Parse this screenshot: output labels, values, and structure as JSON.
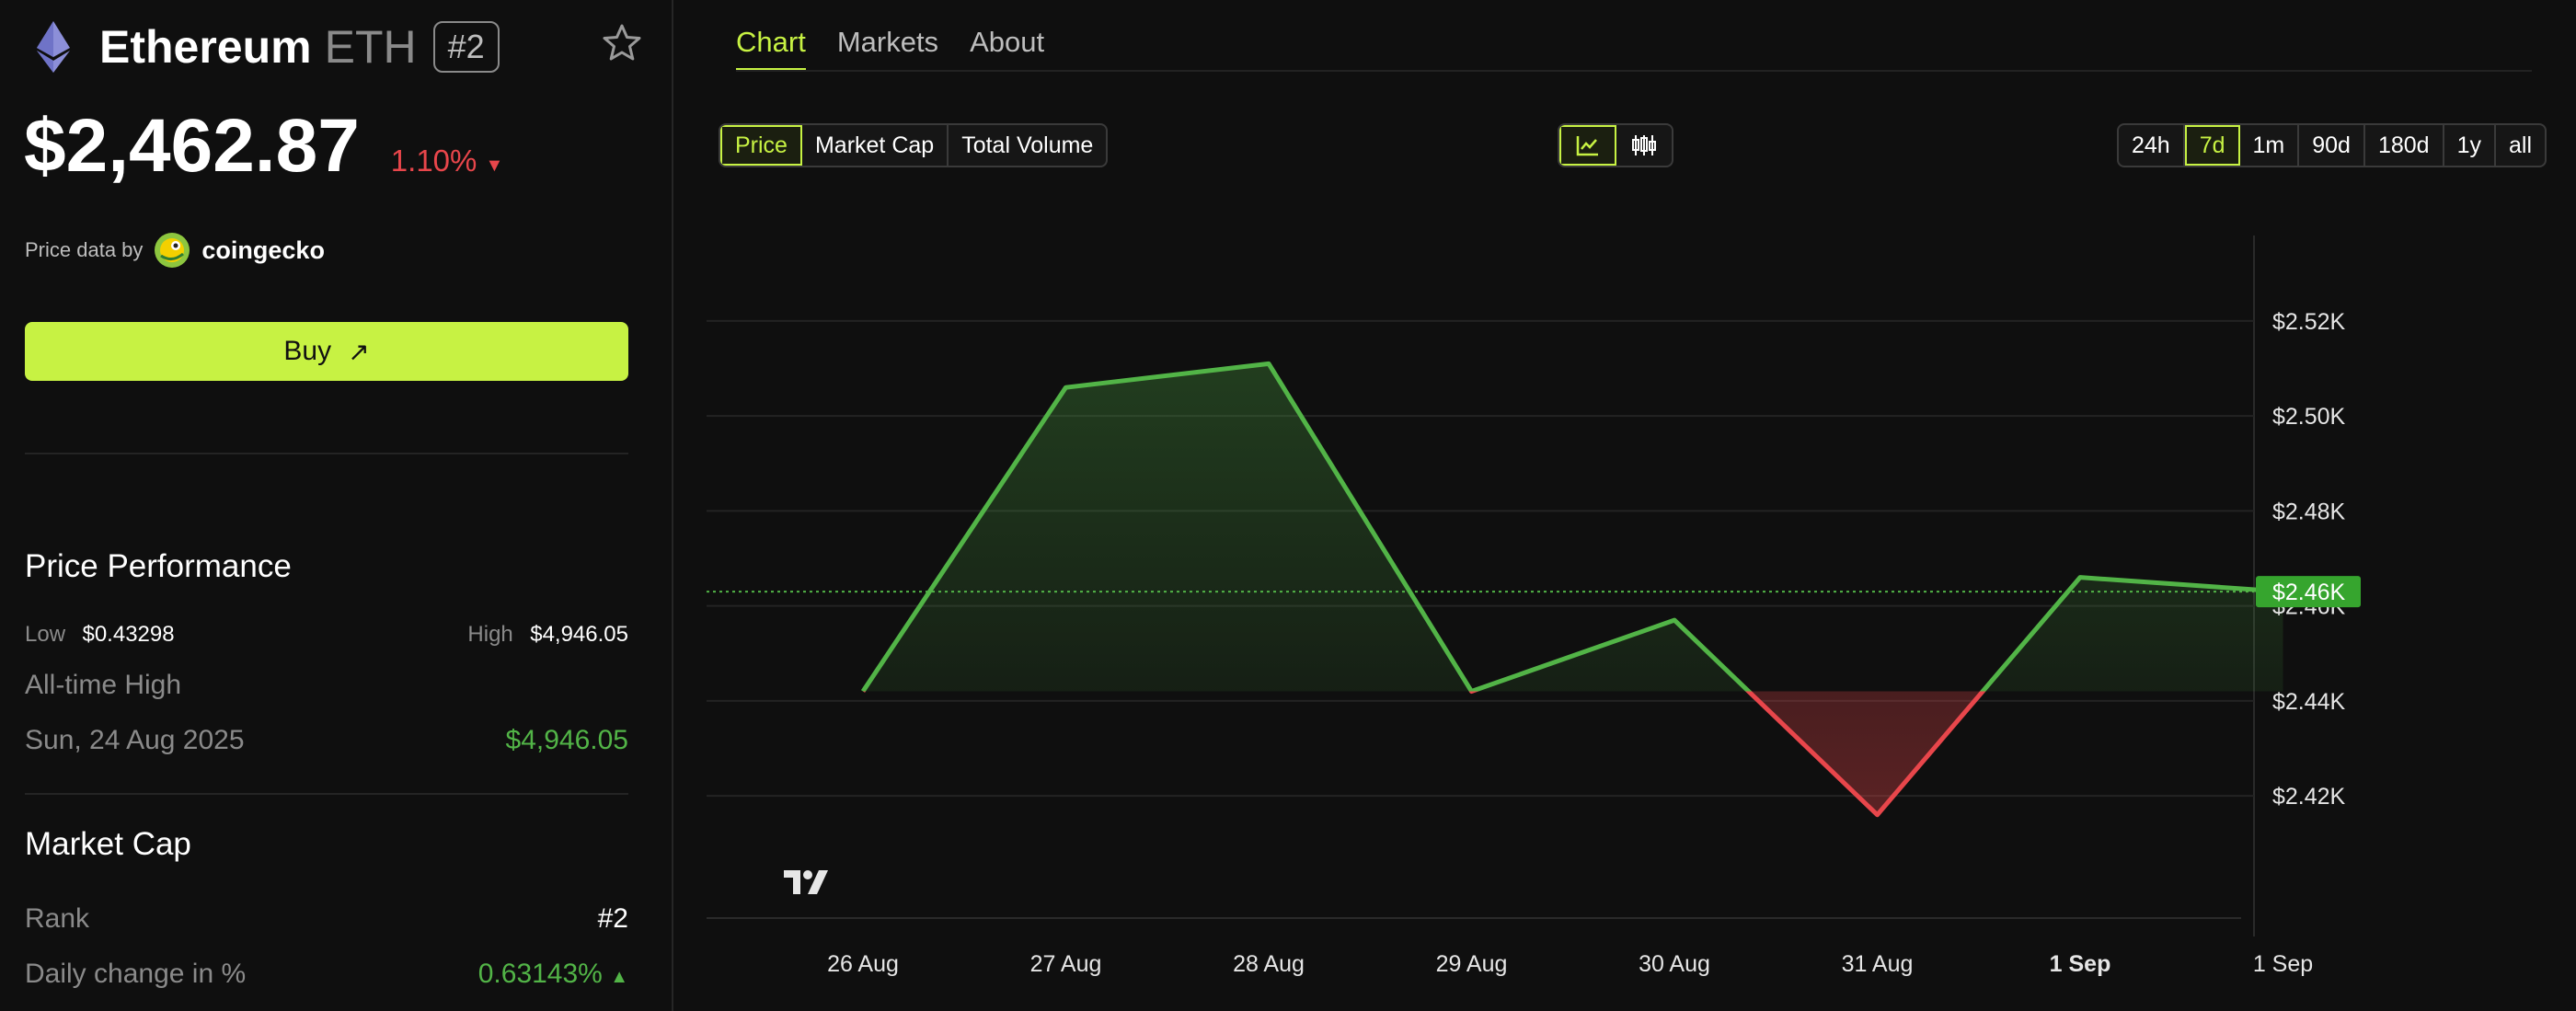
{
  "coin": {
    "name": "Ethereum",
    "symbol": "ETH",
    "rank_badge": "#2",
    "price": "$2,462.87",
    "change": "1.10%",
    "change_arrow": "▼",
    "price_data_label": "Price data by",
    "provider": "coingecko",
    "buy_label": "Buy",
    "buy_arrow": "↗"
  },
  "performance": {
    "title": "Price Performance",
    "low_label": "Low",
    "low_value": "$0.43298",
    "high_label": "High",
    "high_value": "$4,946.05",
    "ath_label": "All-time High",
    "ath_date": "Sun, 24 Aug 2025",
    "ath_value": "$4,946.05"
  },
  "market_cap": {
    "title": "Market Cap",
    "rank_label": "Rank",
    "rank_value": "#2",
    "daily_label": "Daily change in %",
    "daily_value": "0.63143%",
    "daily_arrow": "▲"
  },
  "tabs": [
    "Chart",
    "Markets",
    "About"
  ],
  "metric_options": [
    "Price",
    "Market Cap",
    "Total Volume"
  ],
  "range_options": [
    "24h",
    "7d",
    "1m",
    "90d",
    "180d",
    "1y",
    "all"
  ],
  "icons": {
    "line_chart": "line-chart-icon",
    "candle_chart": "candlestick-icon",
    "star": "star-icon",
    "logo": "ethereum-logo-icon",
    "watermark": "tradingview-logo-icon"
  },
  "colors": {
    "accent": "#c7f243",
    "up": "#52b447",
    "down": "#e8464b",
    "current_badge": "#36a52e"
  },
  "chart_data": {
    "type": "line",
    "x": [
      "26 Aug",
      "27 Aug",
      "28 Aug",
      "29 Aug",
      "30 Aug",
      "31 Aug",
      "1 Sep",
      "1 Sep"
    ],
    "y": [
      2442,
      2506,
      2511,
      2442,
      2457,
      2416,
      2466,
      2463
    ],
    "x_ticks": [
      "26 Aug",
      "27 Aug",
      "28 Aug",
      "29 Aug",
      "30 Aug",
      "31 Aug",
      "1 Sep",
      "1 Sep"
    ],
    "bold_tick_index": 6,
    "y_ticks": [
      "$2.52K",
      "$2.50K",
      "$2.48K",
      "$2.46K",
      "$2.44K",
      "$2.42K"
    ],
    "y_tick_values": [
      2520,
      2500,
      2480,
      2460,
      2440,
      2420
    ],
    "ylim": [
      2402,
      2538
    ],
    "baseline": 2442,
    "current_value": 2463,
    "current_label": "$2.46K",
    "grid": true
  }
}
